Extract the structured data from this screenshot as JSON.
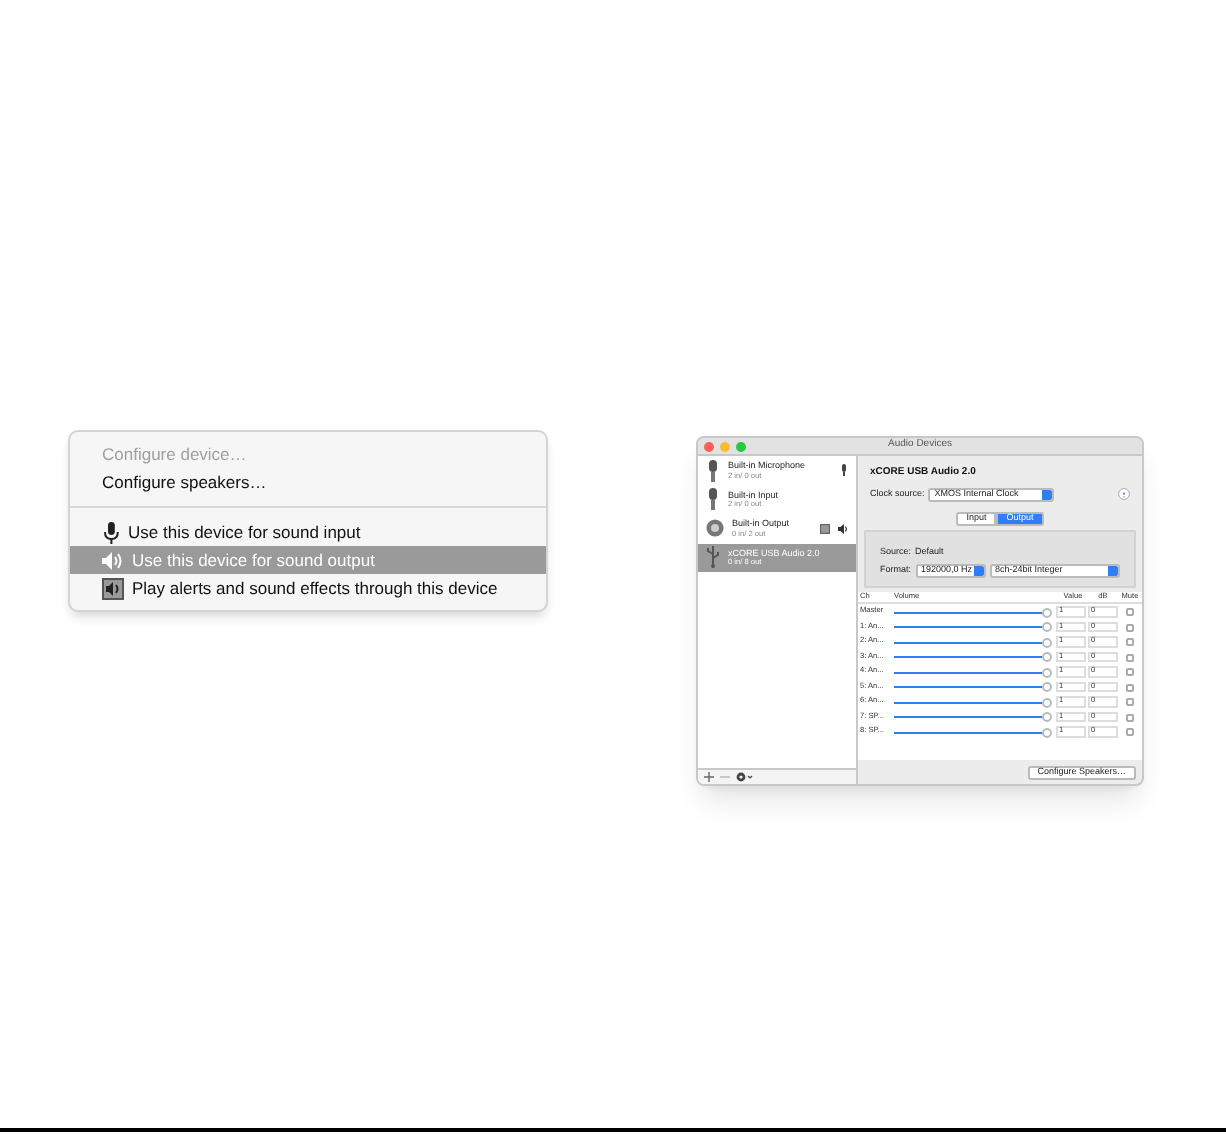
{
  "context_menu": {
    "items": [
      {
        "kind": "plain",
        "label": "Configure device…",
        "disabled": true,
        "selected": false
      },
      {
        "kind": "plain",
        "label": "Configure speakers…",
        "disabled": false,
        "selected": false
      },
      {
        "kind": "separator"
      },
      {
        "kind": "mic",
        "label": "Use this device for sound input",
        "disabled": false,
        "selected": false
      },
      {
        "kind": "speaker",
        "label": "Use this device for sound output",
        "disabled": false,
        "selected": true
      },
      {
        "kind": "alert",
        "label": "Play alerts and sound effects through this device",
        "disabled": false,
        "selected": false
      }
    ]
  },
  "window": {
    "title": "Audio Devices",
    "devices": [
      {
        "kind": "mic",
        "name": "Built-in Microphone",
        "io": "2 in/ 0 out",
        "selected": false,
        "default_input": true,
        "default_output": false
      },
      {
        "kind": "mic",
        "name": "Built-in Input",
        "io": "2 in/ 0 out",
        "selected": false,
        "default_input": false,
        "default_output": false
      },
      {
        "kind": "speaker",
        "name": "Built-in Output",
        "io": "0 in/ 2 out",
        "selected": false,
        "default_input": false,
        "default_output": true
      },
      {
        "kind": "usb",
        "name": "xCORE USB Audio 2.0",
        "io": "0 in/ 8 out",
        "selected": true,
        "default_input": false,
        "default_output": false
      }
    ],
    "device_title": "xCORE USB Audio 2.0",
    "clock_label": "Clock source:",
    "clock_value": "XMOS Internal Clock",
    "tabs": [
      {
        "label": "Input",
        "selected": false
      },
      {
        "label": "Output",
        "selected": true
      }
    ],
    "source_label": "Source:",
    "source_value": "Default",
    "format_label": "Format:",
    "format_rate": "192000,0 Hz",
    "format_bits": "8ch-24bit Integer",
    "columns": [
      "Ch",
      "Volume",
      "Value",
      "dB",
      "Mute"
    ],
    "channels": [
      {
        "name": "Master",
        "level": 1,
        "value": "1",
        "db": "0",
        "muted": false
      },
      {
        "name": "1: An...",
        "level": 1,
        "value": "1",
        "db": "0",
        "muted": false
      },
      {
        "name": "2: An...",
        "level": 1,
        "value": "1",
        "db": "0",
        "muted": false
      },
      {
        "name": "3: An...",
        "level": 1,
        "value": "1",
        "db": "0",
        "muted": false
      },
      {
        "name": "4: An...",
        "level": 1,
        "value": "1",
        "db": "0",
        "muted": false
      },
      {
        "name": "5: An...",
        "level": 1,
        "value": "1",
        "db": "0",
        "muted": false
      },
      {
        "name": "6: An...",
        "level": 1,
        "value": "1",
        "db": "0",
        "muted": false
      },
      {
        "name": "7: SP...",
        "level": 1,
        "value": "1",
        "db": "0",
        "muted": false
      },
      {
        "name": "8: SP...",
        "level": 1,
        "value": "1",
        "db": "0",
        "muted": false
      }
    ],
    "button": "Configure Speakers…"
  }
}
